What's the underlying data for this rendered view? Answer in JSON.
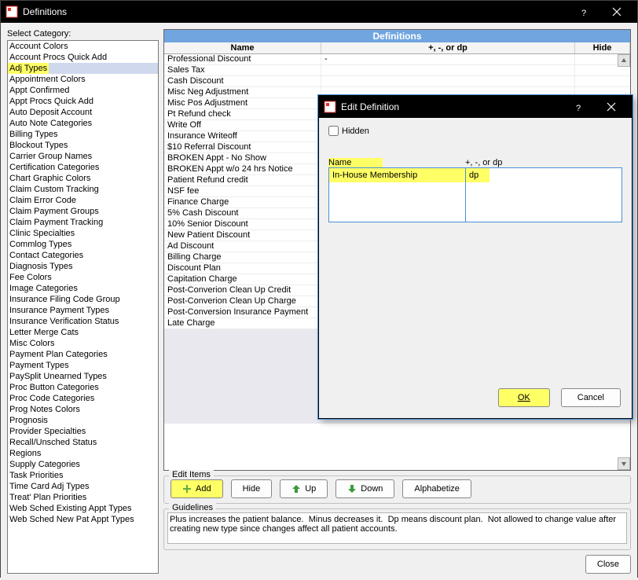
{
  "window": {
    "title": "Definitions"
  },
  "left": {
    "label": "Select Category:",
    "items": [
      "Account Colors",
      "Account Procs Quick Add",
      "Adj Types",
      "Appointment Colors",
      "Appt Confirmed",
      "Appt Procs Quick Add",
      "Auto Deposit Account",
      "Auto Note Categories",
      "Billing Types",
      "Blockout Types",
      "Carrier Group Names",
      "Certification Categories",
      "Chart Graphic Colors",
      "Claim Custom Tracking",
      "Claim Error Code",
      "Claim Payment Groups",
      "Claim Payment Tracking",
      "Clinic Specialties",
      "Commlog Types",
      "Contact Categories",
      "Diagnosis Types",
      "Fee Colors",
      "Image Categories",
      "Insurance Filing Code Group",
      "Insurance Payment Types",
      "Insurance Verification Status",
      "Letter Merge Cats",
      "Misc Colors",
      "Payment Plan Categories",
      "Payment Types",
      "PaySplit Unearned Types",
      "Proc Button Categories",
      "Proc Code Categories",
      "Prog Notes Colors",
      "Prognosis",
      "Provider Specialties",
      "Recall/Unsched Status",
      "Regions",
      "Supply Categories",
      "Task Priorities",
      "Time Card Adj Types",
      "Treat' Plan Priorities",
      "Web Sched Existing Appt Types",
      "Web Sched New Pat Appt Types"
    ],
    "selected_index": 2
  },
  "grid": {
    "title": "Definitions",
    "col_name": "Name",
    "col_dp": "+, -, or dp",
    "col_hide": "Hide",
    "rows": [
      {
        "name": "Professional Discount",
        "dp": "-"
      },
      {
        "name": "Sales Tax",
        "dp": ""
      },
      {
        "name": "Cash Discount",
        "dp": ""
      },
      {
        "name": "Misc Neg Adjustment",
        "dp": ""
      },
      {
        "name": "Misc Pos Adjustment",
        "dp": ""
      },
      {
        "name": "Pt Refund check",
        "dp": ""
      },
      {
        "name": "Write Off",
        "dp": ""
      },
      {
        "name": "Insurance Writeoff",
        "dp": ""
      },
      {
        "name": "$10 Referral Discount",
        "dp": ""
      },
      {
        "name": "BROKEN Appt - No Show",
        "dp": ""
      },
      {
        "name": "BROKEN Appt w/o 24 hrs Notice",
        "dp": ""
      },
      {
        "name": "Patient Refund credit",
        "dp": ""
      },
      {
        "name": "NSF fee",
        "dp": ""
      },
      {
        "name": "Finance Charge",
        "dp": ""
      },
      {
        "name": "5% Cash Discount",
        "dp": ""
      },
      {
        "name": "10% Senior Discount",
        "dp": ""
      },
      {
        "name": "New Patient Discount",
        "dp": ""
      },
      {
        "name": "Ad Discount",
        "dp": ""
      },
      {
        "name": "Billing Charge",
        "dp": ""
      },
      {
        "name": "Discount Plan",
        "dp": ""
      },
      {
        "name": "Capitation Charge",
        "dp": ""
      },
      {
        "name": "Post-Converion Clean Up Credit",
        "dp": ""
      },
      {
        "name": "Post-Converion Clean Up Charge",
        "dp": ""
      },
      {
        "name": "Post-Conversion Insurance Payment",
        "dp": ""
      },
      {
        "name": "Late Charge",
        "dp": ""
      }
    ]
  },
  "edit_items": {
    "legend": "Edit Items",
    "add": "Add",
    "hide": "Hide",
    "up": "Up",
    "down": "Down",
    "alphabetize": "Alphabetize"
  },
  "guidelines": {
    "legend": "Guidelines",
    "text": "Plus increases the patient balance.  Minus decreases it.  Dp means discount plan.  Not allowed to change value after creating new type since changes affect all patient accounts."
  },
  "close": "Close",
  "modal": {
    "title": "Edit Definition",
    "hidden_label": "Hidden",
    "name_label": "Name",
    "dp_label": "+, -, or dp",
    "name_value": "In-House Membership",
    "dp_value": "dp",
    "ok": "OK",
    "cancel": "Cancel"
  }
}
